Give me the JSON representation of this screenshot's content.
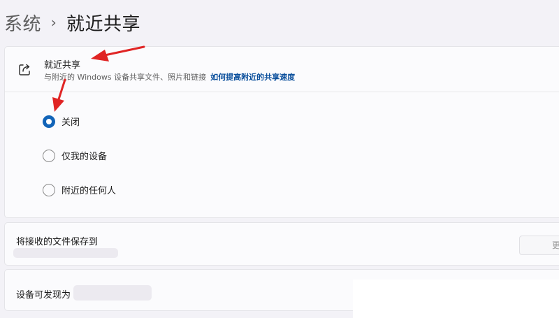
{
  "breadcrumb": {
    "parent": "系统",
    "separator": "›",
    "current": "就近共享"
  },
  "nearby_sharing": {
    "icon": "share-icon",
    "title": "就近共享",
    "description": "与附近的 Windows 设备共享文件、照片和链接",
    "link": "如何提高附近的共享速度",
    "options": [
      {
        "label": "关闭",
        "selected": true
      },
      {
        "label": "仅我的设备",
        "selected": false
      },
      {
        "label": "附近的任何人",
        "selected": false
      }
    ]
  },
  "save_files": {
    "label": "将接收的文件保存到",
    "button_label": "更"
  },
  "discoverable": {
    "label": "设备可发现为"
  },
  "colors": {
    "accent": "#1264b8",
    "link": "#0a4f9c",
    "annotation_arrow": "#e02424"
  }
}
